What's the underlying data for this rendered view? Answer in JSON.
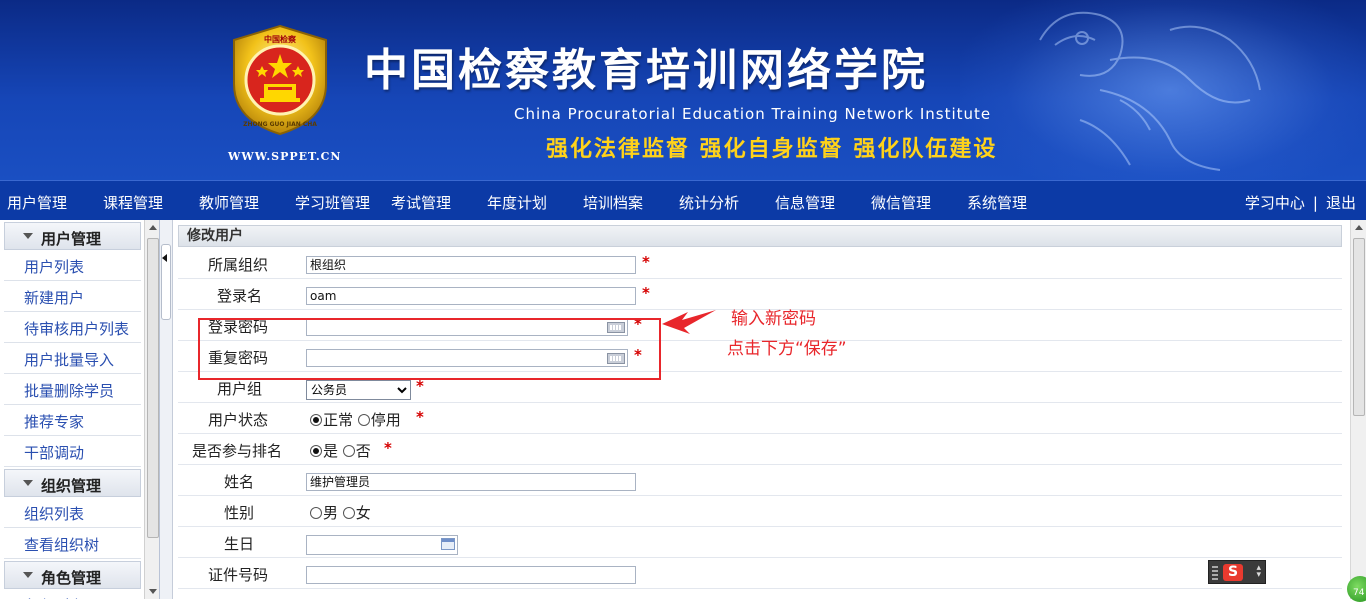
{
  "header": {
    "emblem_top_text": "中国检察",
    "emblem_ring_text": "ZHONG GUO JIAN CHA",
    "site_url": "WWW.SPPET.CN",
    "title": "中国检察教育培训网络学院",
    "subtitle_en": "China Procuratorial Education Training Network Institute",
    "slogan": "强化法律监督  强化自身监督  强化队伍建设"
  },
  "nav": {
    "items": [
      "用户管理",
      "课程管理",
      "教师管理",
      "学习班管理",
      "考试管理",
      "年度计划",
      "培训档案",
      "统计分析",
      "信息管理",
      "微信管理",
      "系统管理"
    ],
    "learning_center": "学习中心",
    "separator": "|",
    "logout": "退出"
  },
  "sidebar": {
    "groups": [
      {
        "title": "用户管理",
        "items": [
          "用户列表",
          "新建用户",
          "待审核用户列表",
          "用户批量导入",
          "批量删除学员",
          "推荐专家",
          "干部调动"
        ]
      },
      {
        "title": "组织管理",
        "items": [
          "组织列表",
          "查看组织树"
        ]
      },
      {
        "title": "角色管理",
        "items": [
          "角色列表"
        ]
      }
    ]
  },
  "form": {
    "panel_title": "修改用户",
    "required_mark": "*",
    "fields": {
      "org": {
        "label": "所属组织",
        "value": "根组织"
      },
      "login_name": {
        "label": "登录名",
        "value": "oam"
      },
      "password": {
        "label": "登录密码",
        "value": ""
      },
      "password_repeat": {
        "label": "重复密码",
        "value": ""
      },
      "user_group": {
        "label": "用户组",
        "value": "公务员"
      },
      "status": {
        "label": "用户状态",
        "options": [
          "正常",
          "停用"
        ],
        "selected": "正常"
      },
      "ranking": {
        "label": "是否参与排名",
        "options": [
          "是",
          "否"
        ],
        "selected": "是"
      },
      "name": {
        "label": "姓名",
        "value": "维护管理员"
      },
      "gender": {
        "label": "性别",
        "options": [
          "男",
          "女"
        ],
        "selected": ""
      },
      "birthday": {
        "label": "生日",
        "value": ""
      },
      "id_number": {
        "label": "证件号码",
        "value": ""
      }
    }
  },
  "annotation": {
    "line1": "输入新密码",
    "line2": "点击下方“保存”",
    "color": "#e8262b"
  },
  "ime": {
    "logo": "S"
  },
  "badge": {
    "value": "74"
  }
}
